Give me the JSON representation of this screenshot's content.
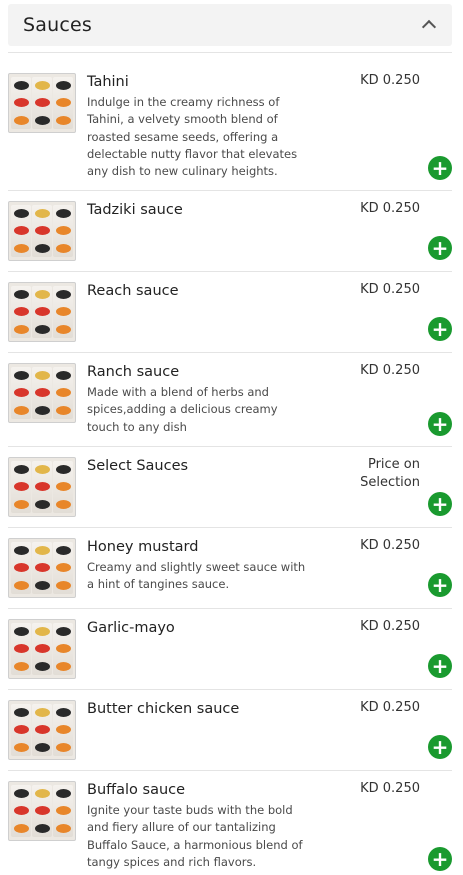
{
  "section": {
    "title": "Sauces",
    "collapse_icon": "chevron-up-icon"
  },
  "add_icon": "plus-icon",
  "accent_color": "#1a9a2f",
  "items": [
    {
      "name": "Tahini",
      "description": "Indulge in the creamy richness of Tahini, a velvety smooth blend of roasted sesame seeds, offering a delectable nutty flavor that elevates any dish to new culinary heights.",
      "price": "KD 0.250"
    },
    {
      "name": "Tadziki sauce",
      "description": "",
      "price": "KD 0.250"
    },
    {
      "name": "Reach sauce",
      "description": "",
      "price": "KD 0.250"
    },
    {
      "name": "Ranch sauce",
      "description": "Made with a blend of herbs and spices,adding a delicious creamy touch to any dish",
      "price": "KD 0.250"
    },
    {
      "name": "Select Sauces",
      "description": "",
      "price_line1": "Price on",
      "price_line2": "Selection"
    },
    {
      "name": "Honey mustard",
      "description": "Creamy and slightly sweet sauce with a hint of tangines sauce.",
      "price": "KD 0.250"
    },
    {
      "name": "Garlic-mayo",
      "description": "",
      "price": "KD 0.250"
    },
    {
      "name": "Butter chicken sauce",
      "description": "",
      "price": "KD 0.250"
    },
    {
      "name": "Buffalo sauce",
      "description": "Ignite your taste buds with the bold and fiery allure of our tantalizing Buffalo Sauce, a harmonious blend of tangy spices and rich flavors.",
      "price": "KD 0.250"
    }
  ]
}
